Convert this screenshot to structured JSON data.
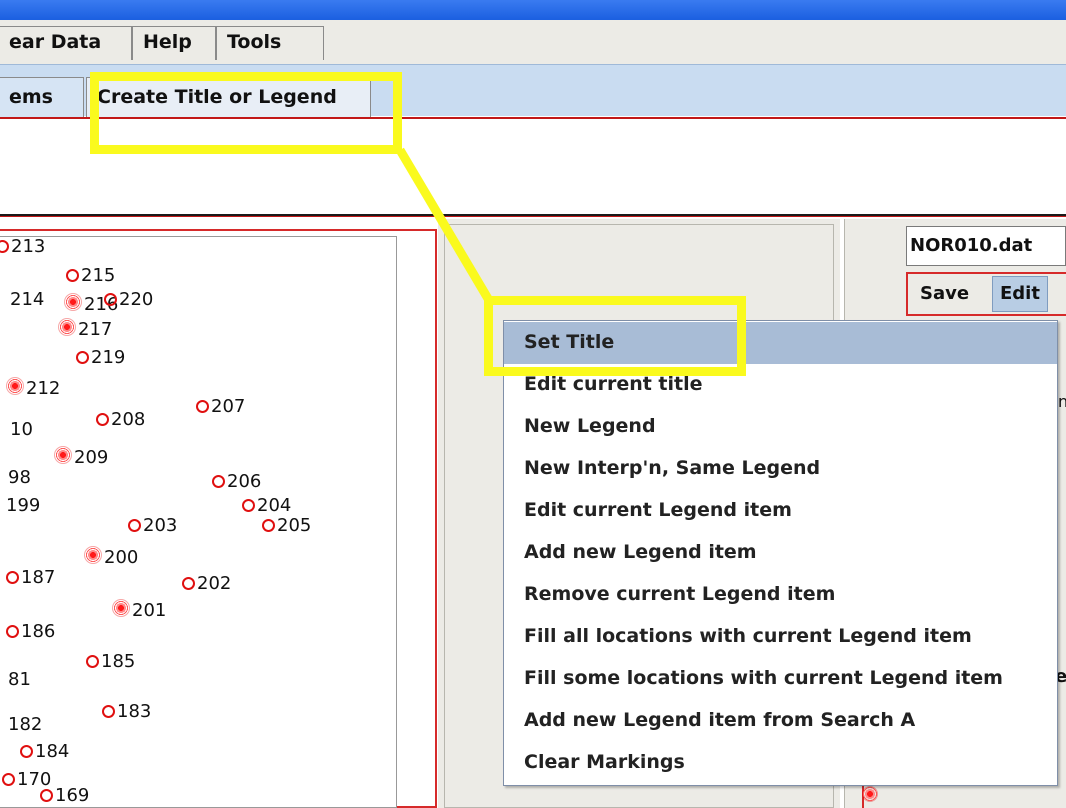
{
  "menubar": {
    "tabs": [
      "ear Data",
      "Help",
      "Tools"
    ]
  },
  "subbar": {
    "tabs": [
      "ems",
      "Create Title or Legend"
    ]
  },
  "map": {
    "stations": [
      {
        "label": "213",
        "marker": "open"
      },
      {
        "label": "215",
        "marker": "open"
      },
      {
        "label": "214",
        "marker": "none"
      },
      {
        "label": "216",
        "marker": "burst"
      },
      {
        "label": "220",
        "marker": "open"
      },
      {
        "label": "217",
        "marker": "burst"
      },
      {
        "label": "219",
        "marker": "open"
      },
      {
        "label": "212",
        "marker": "burst"
      },
      {
        "label": "207",
        "marker": "open"
      },
      {
        "label": "208",
        "marker": "open"
      },
      {
        "label": "10",
        "marker": "none"
      },
      {
        "label": "209",
        "marker": "burst"
      },
      {
        "label": "98",
        "marker": "none"
      },
      {
        "label": "206",
        "marker": "open"
      },
      {
        "label": "199",
        "marker": "none"
      },
      {
        "label": "204",
        "marker": "open"
      },
      {
        "label": "203",
        "marker": "open"
      },
      {
        "label": "205",
        "marker": "open"
      },
      {
        "label": "200",
        "marker": "burst"
      },
      {
        "label": "187",
        "marker": "open"
      },
      {
        "label": "202",
        "marker": "open"
      },
      {
        "label": "201",
        "marker": "burst"
      },
      {
        "label": "186",
        "marker": "open"
      },
      {
        "label": "185",
        "marker": "open"
      },
      {
        "label": "81",
        "marker": "none"
      },
      {
        "label": "183",
        "marker": "open"
      },
      {
        "label": "182",
        "marker": "none"
      },
      {
        "label": "184",
        "marker": "open"
      },
      {
        "label": "170",
        "marker": "open"
      },
      {
        "label": "169",
        "marker": "open"
      }
    ]
  },
  "right_panel": {
    "file_name": "NOR010.dat",
    "save_label": "Save",
    "edit_label": "Edit",
    "clip_a": "n",
    "clip_b": "e"
  },
  "menu": {
    "items": [
      "Set Title",
      "Edit current title",
      "New Legend",
      "New Interp'n, Same Legend",
      "Edit current Legend item",
      "Add new Legend item",
      "Remove current Legend item",
      "Fill all locations with current Legend item",
      "Fill some locations with current Legend item",
      "Add new Legend item from Search A",
      "Clear Markings"
    ],
    "selected_index": 0
  },
  "colors": {
    "highlight": "#fafa1e",
    "menu_selection": "#a8bcd6",
    "marker": "#e01010"
  }
}
